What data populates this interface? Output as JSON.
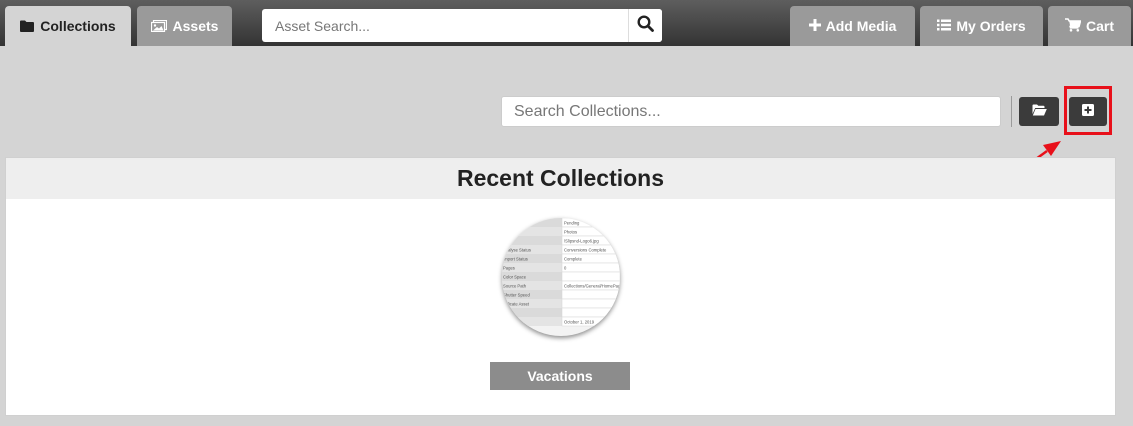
{
  "topbar": {
    "tabs": [
      {
        "label": "Collections",
        "icon": "folder-icon",
        "active": true
      },
      {
        "label": "Assets",
        "icon": "images-icon",
        "active": false
      }
    ],
    "asset_search": {
      "placeholder": "Asset Search...",
      "value": ""
    },
    "right_buttons": [
      {
        "label": "Add Media",
        "icon": "plus-icon"
      },
      {
        "label": "My Orders",
        "icon": "list-icon"
      },
      {
        "label": "Cart",
        "icon": "cart-icon"
      }
    ]
  },
  "toolbar": {
    "collection_search": {
      "placeholder": "Search Collections...",
      "value": ""
    },
    "folder_button_icon": "folder-open-icon",
    "new_collection_button_icon": "plus-square-icon",
    "annotation_color": "#e8101a"
  },
  "recent": {
    "title": "Recent Collections",
    "collections": [
      {
        "name": "Vacations",
        "thumbnail_rows": [
          [
            "",
            "Pending"
          ],
          [
            "",
            "Photos"
          ],
          [
            "",
            "/Slipsnd-Logo6.jpg"
          ],
          [
            "Analyse Status",
            "Conversions Complete"
          ],
          [
            "Import Status",
            "Complete"
          ],
          [
            "Pages",
            "0"
          ],
          [
            "Color Space",
            ""
          ],
          [
            "Source Path",
            "Collections/General/HomePage/vt"
          ],
          [
            "Shutter Speed",
            ""
          ],
          [
            "Indicate Asset",
            ""
          ],
          [
            "",
            ""
          ],
          [
            "",
            "October 1, 2019"
          ]
        ]
      }
    ]
  },
  "colors": {
    "topbar": "#444444",
    "tab_inactive": "#9a9a9a",
    "dark_button": "#3b3b3b",
    "page_bg": "#d4d4d4"
  }
}
